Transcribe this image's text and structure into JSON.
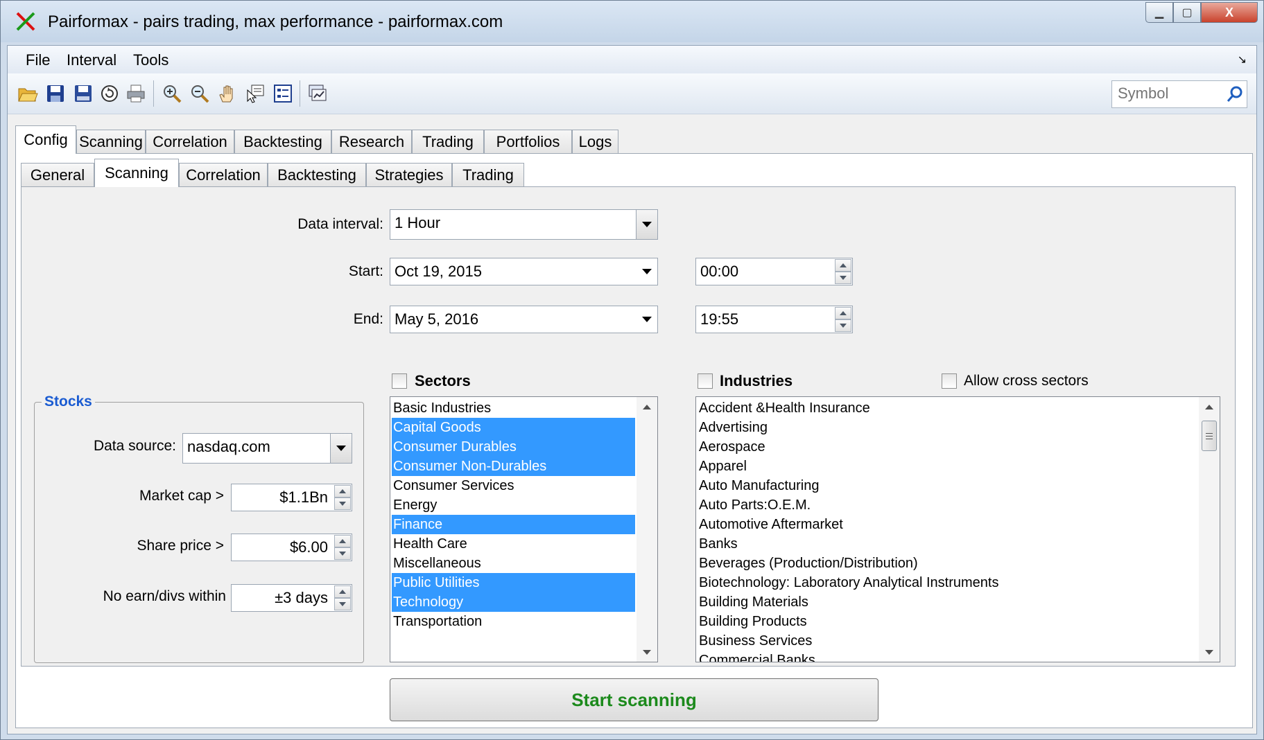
{
  "window": {
    "title": "Pairformax - pairs trading, max performance - pairformax.com",
    "controls": {
      "minimize": "▁",
      "maximize": "▢",
      "close": "X"
    }
  },
  "menu": [
    "File",
    "Interval",
    "Tools"
  ],
  "toolbar": {
    "icons": [
      "open-folder-icon",
      "save-icon",
      "save-as-icon",
      "reload-icon",
      "print-icon",
      "zoom-in-icon",
      "zoom-out-icon",
      "pan-hand-icon",
      "select-cursor-icon",
      "properties-icon",
      "chart-window-icon"
    ],
    "symbol_placeholder": "Symbol"
  },
  "main_tabs": [
    "Config",
    "Scanning",
    "Correlation",
    "Backtesting",
    "Research",
    "Trading",
    "Portfolios",
    "Logs"
  ],
  "sub_tabs": [
    "General",
    "Scanning",
    "Correlation",
    "Backtesting",
    "Strategies",
    "Trading"
  ],
  "scan": {
    "data_interval_label": "Data interval:",
    "data_interval_value": "1 Hour",
    "start_label": "Start:",
    "start_date": "Oct 19, 2015",
    "start_time": "00:00",
    "end_label": "End:",
    "end_date": "May 5, 2016",
    "end_time": "19:55"
  },
  "stocks": {
    "title": "Stocks",
    "data_source_label": "Data source:",
    "data_source_value": "nasdaq.com",
    "market_cap_label": "Market cap >",
    "market_cap_value": "$1.1Bn",
    "share_price_label": "Share price >",
    "share_price_value": "$6.00",
    "earn_label": "No earn/divs within",
    "earn_value": "±3 days"
  },
  "sectors": {
    "label": "Sectors",
    "items": [
      {
        "name": "Basic Industries",
        "selected": false
      },
      {
        "name": "Capital Goods",
        "selected": true
      },
      {
        "name": "Consumer Durables",
        "selected": true
      },
      {
        "name": "Consumer Non-Durables",
        "selected": true
      },
      {
        "name": "Consumer Services",
        "selected": false
      },
      {
        "name": "Energy",
        "selected": false
      },
      {
        "name": "Finance",
        "selected": true
      },
      {
        "name": "Health Care",
        "selected": false
      },
      {
        "name": "Miscellaneous",
        "selected": false
      },
      {
        "name": "Public Utilities",
        "selected": true
      },
      {
        "name": "Technology",
        "selected": true
      },
      {
        "name": "Transportation",
        "selected": false
      }
    ]
  },
  "industries": {
    "label": "Industries",
    "cross_label": "Allow cross sectors",
    "items": [
      "Accident &Health Insurance",
      "Advertising",
      "Aerospace",
      "Apparel",
      "Auto Manufacturing",
      "Auto Parts:O.E.M.",
      "Automotive Aftermarket",
      "Banks",
      "Beverages (Production/Distribution)",
      "Biotechnology: Laboratory Analytical Instruments",
      "Building Materials",
      "Building Products",
      "Business Services",
      "Commercial Banks"
    ]
  },
  "actions": {
    "start_scanning": "Start scanning"
  },
  "colors": {
    "selection": "#3399ff",
    "start_text": "#1c8a1c",
    "group_title": "#1a5bd1"
  }
}
